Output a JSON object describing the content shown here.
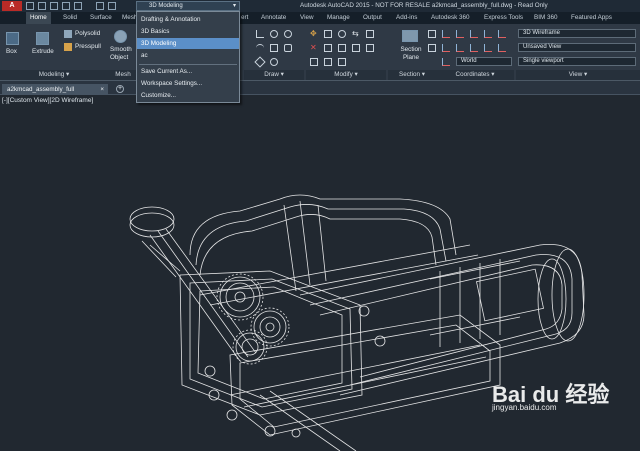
{
  "app": {
    "logo_label": "A",
    "title": "Autodesk AutoCAD 2015 - NOT FOR RESALE    a2kmcad_assembly_full.dwg - Read Only",
    "workspace_selected": "3D Modeling"
  },
  "tabs": [
    "Home",
    "Solid",
    "Surface",
    "Mesh",
    "ert",
    "Annotate",
    "View",
    "Manage",
    "Output",
    "Add-ins",
    "Autodesk 360",
    "Express Tools",
    "BIM 360",
    "Featured Apps"
  ],
  "workspace_menu": {
    "items": [
      "Drafting & Annotation",
      "3D Basics",
      "3D Modeling",
      "ac",
      "Save Current As...",
      "Workspace Settings...",
      "Customize..."
    ],
    "selected_index": 2
  },
  "ribbon": {
    "box_label": "Box",
    "extrude_label": "Extrude",
    "polysolid_label": "Polysolid",
    "presspull_label": "Presspull",
    "smooth_object_label": "Smooth Object",
    "modeling_panel": "Modeling",
    "mesh_panel": "Mesh",
    "draw_panel": "Draw",
    "modify_panel": "Modify",
    "section_panel": "Section",
    "section_plane_label": "Section Plane",
    "coordinates_panel": "Coordinates",
    "view_panel": "View",
    "ucs_value": "World",
    "visual_style_value": "3D Wireframe",
    "saved_view_value": "Unsaved View",
    "viewport_value": "Single viewport"
  },
  "document": {
    "file_tab": "a2kmcad_assembly_full",
    "new_tab_symbol": "+",
    "viewport_label": "[-][Custom View][2D Wireframe]"
  },
  "watermark": {
    "logo": "Bai du 经验",
    "url": "jingyan.baidu.com"
  },
  "colors": {
    "viewport_bg": "#212830",
    "ribbon_bg": "#2f3945",
    "menu_highlight": "#5b8fc8",
    "app_button": "#b92b27",
    "wireframe": "#ffffff"
  }
}
